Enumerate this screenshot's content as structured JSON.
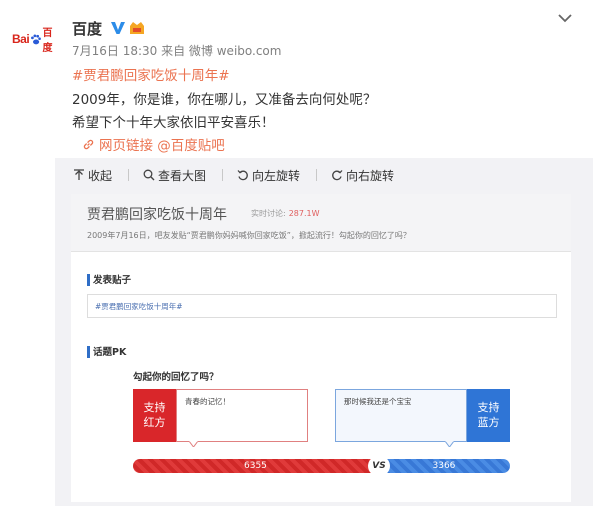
{
  "post": {
    "avatar": {
      "logo_text_left": "Bai",
      "logo_text_right": "百度",
      "icon": "baidu-paw-logo"
    },
    "username": "百度",
    "verified_icon": "verified-v-icon",
    "vip_icon": "vip-badge-icon",
    "menu_icon": "chevron-down-icon",
    "meta": "7月16日 18:30 来自 微博 weibo.com",
    "hashtag": "#贾君鹏回家吃饭十周年#",
    "line1": "2009年，你是谁，你在哪儿，又准备去向何处呢？",
    "line2": "希望下个十年大家依旧平安喜乐！",
    "link_text": "网页链接 @百度贴吧",
    "link_icon": "link-icon"
  },
  "toolbar": {
    "collapse": "收起",
    "view_large": "查看大图",
    "rotate_left": "向左旋转",
    "rotate_right": "向右旋转"
  },
  "image": {
    "title": "贾君鹏回家吃饭十周年",
    "stat_label": "实时讨论:",
    "stat_value": "287.1W",
    "desc": "2009年7月16日，吧友发贴“贾君鹏你妈妈喊你回家吃饭”，掀起流行！勾起你的回忆了吗？",
    "section_post": "发表贴子",
    "post_tag": "#贾君鹏回家吃饭十周年#",
    "section_pk": "话题PK",
    "pk_question": "勾起你的回忆了吗？",
    "red_label": "支持\n红方",
    "red_label_1": "支持",
    "red_label_2": "红方",
    "red_text": "青春的记忆！",
    "blue_text": "那时候我还是个宝宝",
    "blue_label_1": "支持",
    "blue_label_2": "蓝方",
    "red_count": "6355",
    "blue_count": "3366",
    "vs": "VS",
    "red_value": 6355,
    "blue_value": 3366
  },
  "colors": {
    "accent": "#eb7350",
    "red": "#d9262a",
    "blue": "#2f75d6"
  }
}
